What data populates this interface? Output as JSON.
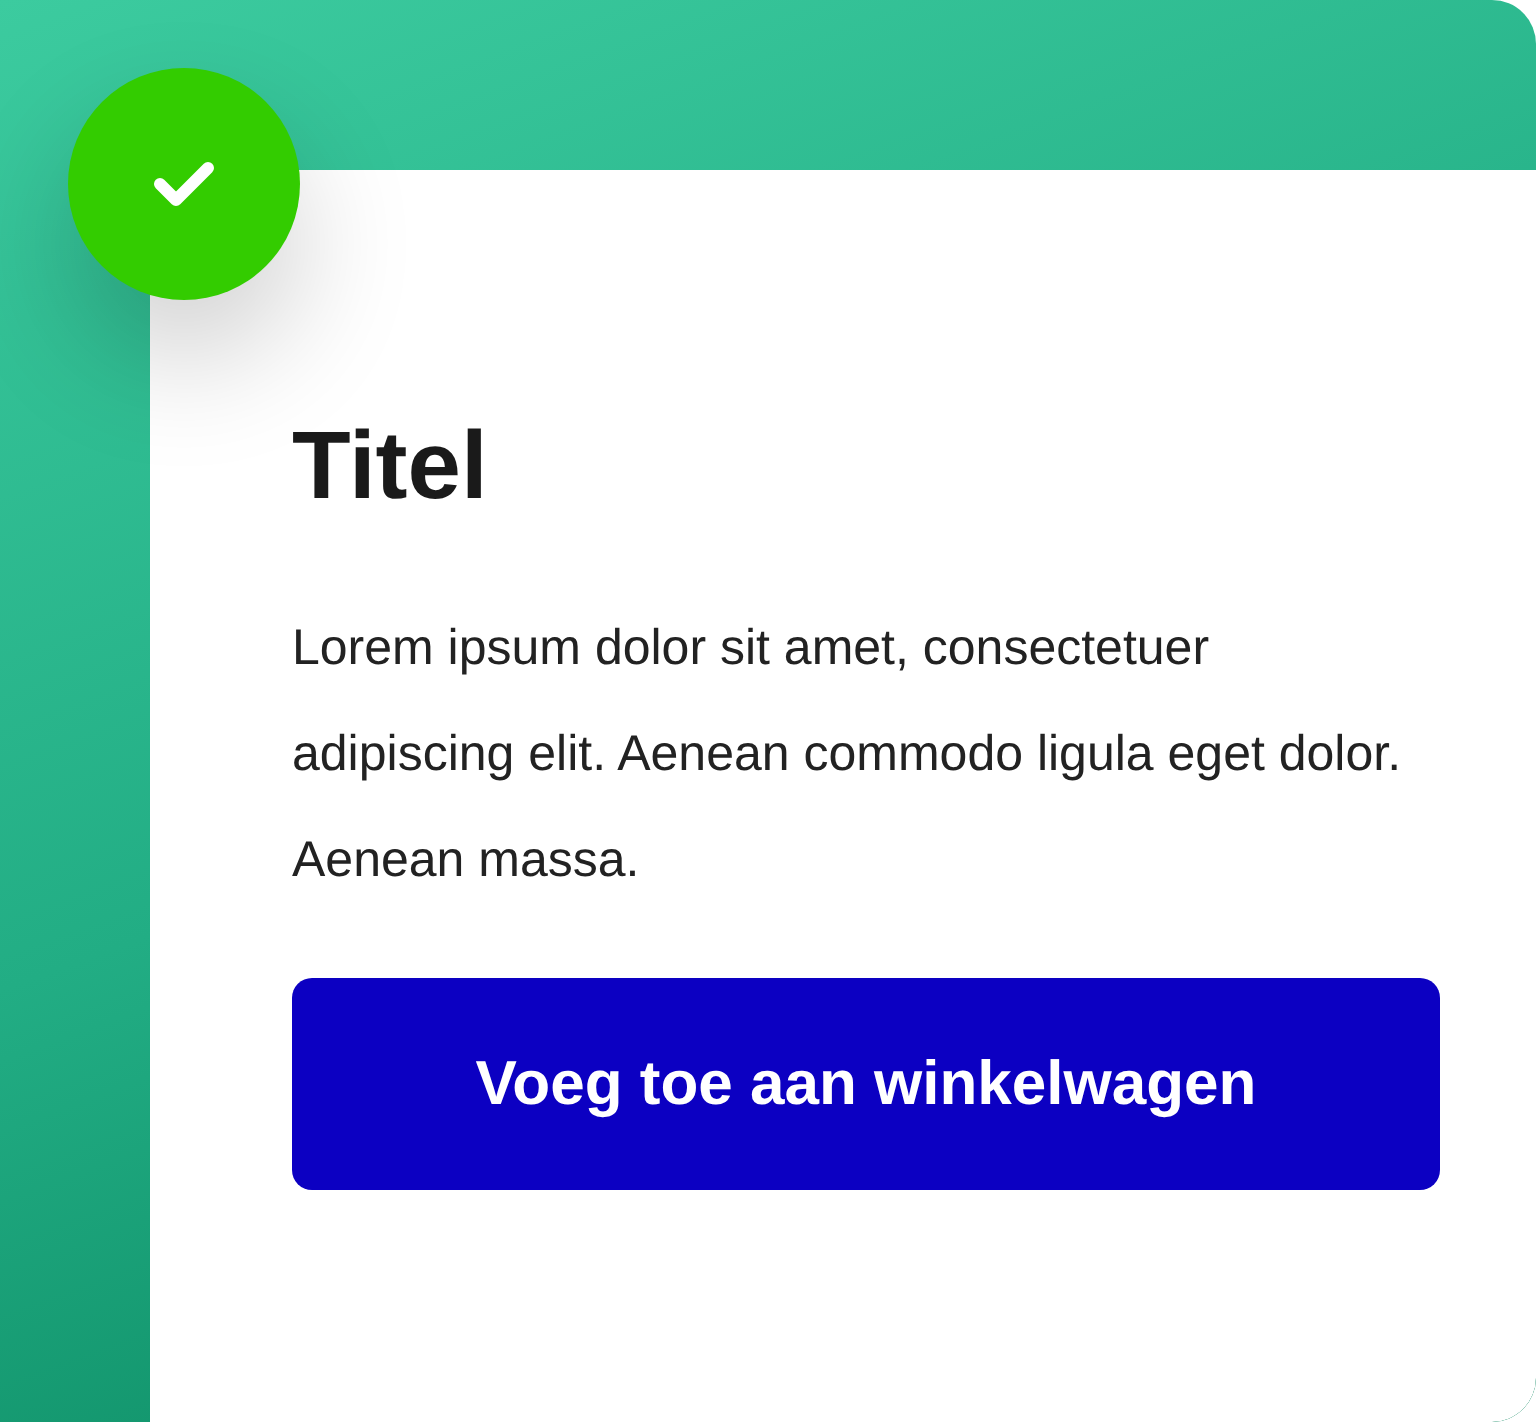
{
  "badge": {
    "checked": true
  },
  "card": {
    "title": "Titel",
    "body": "Lorem ipsum dolor sit amet, consectetuer adipiscing elit. Aenean commodo ligula eget dolor. Aenean massa.",
    "button": "Voeg toe aan winkelwagen"
  }
}
